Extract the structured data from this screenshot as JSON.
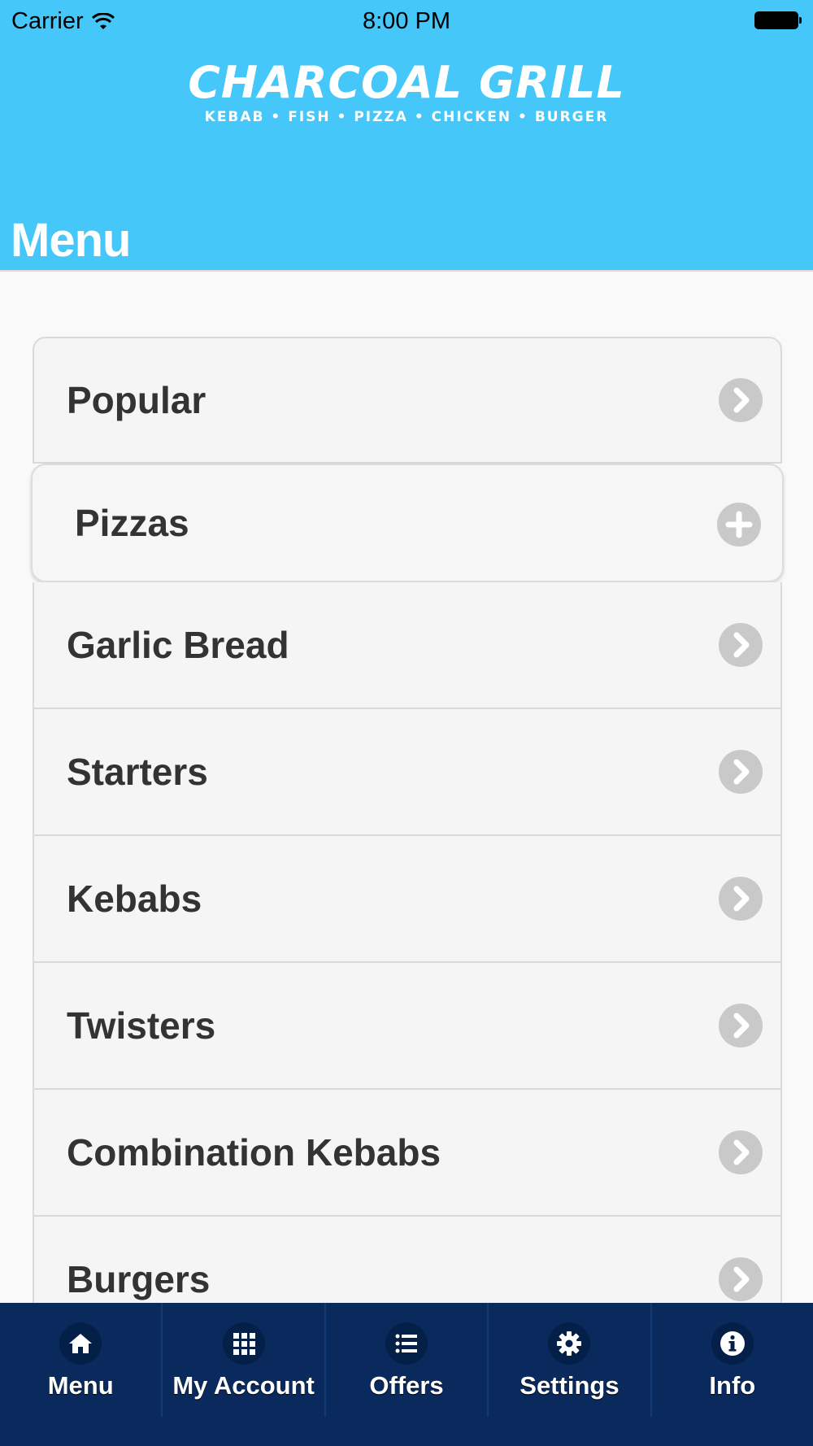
{
  "status_bar": {
    "carrier": "Carrier",
    "time": "8:00 PM"
  },
  "logo": {
    "title": "CHARCOAL GRILL",
    "subtitle": "KEBAB • FISH • PIZZA • CHICKEN • BURGER"
  },
  "page_title": "Menu",
  "menu": {
    "items": [
      {
        "label": "Popular",
        "icon": "chevron-right-icon"
      },
      {
        "label": "Pizzas",
        "icon": "plus-icon"
      },
      {
        "label": "Garlic Bread",
        "icon": "chevron-right-icon"
      },
      {
        "label": "Starters",
        "icon": "chevron-right-icon"
      },
      {
        "label": "Kebabs",
        "icon": "chevron-right-icon"
      },
      {
        "label": "Twisters",
        "icon": "chevron-right-icon"
      },
      {
        "label": "Combination Kebabs",
        "icon": "chevron-right-icon"
      },
      {
        "label": "Burgers",
        "icon": "chevron-right-icon"
      }
    ]
  },
  "tabbar": {
    "tabs": [
      {
        "label": "Menu",
        "icon": "home-icon"
      },
      {
        "label": "My Account",
        "icon": "grid-icon"
      },
      {
        "label": "Offers",
        "icon": "list-icon"
      },
      {
        "label": "Settings",
        "icon": "gear-icon"
      },
      {
        "label": "Info",
        "icon": "info-icon"
      }
    ]
  },
  "colors": {
    "header": "#46c7fa",
    "tabbar": "#0a2a5e",
    "text": "#333333"
  }
}
